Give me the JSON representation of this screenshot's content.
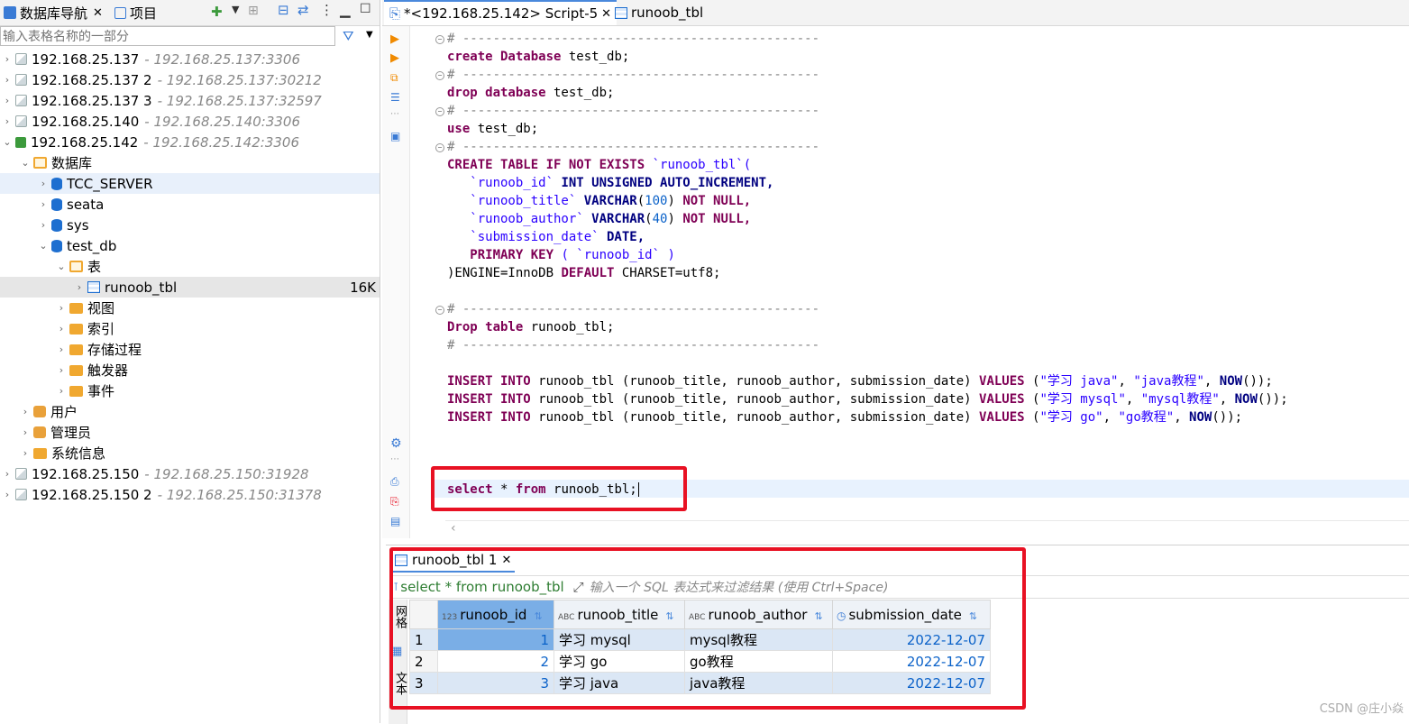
{
  "left_panel": {
    "tabs": [
      {
        "label": "数据库导航"
      },
      {
        "label": "项目"
      }
    ],
    "filter_placeholder": "输入表格名称的一部分",
    "tree": [
      {
        "label": "192.168.25.137",
        "addr": "- 192.168.25.137:3306"
      },
      {
        "label": "192.168.25.137 2",
        "addr": "- 192.168.25.137:30212"
      },
      {
        "label": "192.168.25.137 3",
        "addr": "- 192.168.25.137:32597"
      },
      {
        "label": "192.168.25.140",
        "addr": "- 192.168.25.140:3306"
      },
      {
        "label": "192.168.25.142",
        "addr": "- 192.168.25.142:3306"
      },
      {
        "label": "数据库"
      },
      {
        "label": "TCC_SERVER"
      },
      {
        "label": "seata"
      },
      {
        "label": "sys"
      },
      {
        "label": "test_db"
      },
      {
        "label": "表"
      },
      {
        "label": "runoob_tbl",
        "size": "16K"
      },
      {
        "label": "视图"
      },
      {
        "label": "索引"
      },
      {
        "label": "存储过程"
      },
      {
        "label": "触发器"
      },
      {
        "label": "事件"
      },
      {
        "label": "用户"
      },
      {
        "label": "管理员"
      },
      {
        "label": "系统信息"
      },
      {
        "label": "192.168.25.150",
        "addr": "- 192.168.25.150:31928"
      },
      {
        "label": "192.168.25.150 2",
        "addr": "- 192.168.25.150:31378"
      }
    ]
  },
  "editor": {
    "tabs": [
      {
        "label": "*<192.168.25.142> Script-5"
      },
      {
        "label": "runoob_tbl"
      }
    ],
    "lines": {
      "l1": "# -----------------------------------------------",
      "l2a": "create Database",
      "l2b": " test_db;",
      "l3": "# -----------------------------------------------",
      "l4a": "drop database",
      "l4b": " test_db;",
      "l5": "# -----------------------------------------------",
      "l6a": "use",
      "l6b": " test_db;",
      "l7": "# -----------------------------------------------",
      "l8a": "CREATE TABLE IF NOT EXISTS",
      "l8b": " `runoob_tbl`(",
      "l9a": "   `runoob_id`",
      "l9b": " INT UNSIGNED AUTO_INCREMENT,",
      "l10a": "   `runoob_title`",
      "l10b": " VARCHAR",
      "l10c": "(",
      "l10d": "100",
      "l10e": ")",
      "l10f": " NOT NULL,",
      "l11a": "   `runoob_author`",
      "l11b": " VARCHAR",
      "l11c": "(",
      "l11d": "40",
      "l11e": ")",
      "l11f": " NOT NULL,",
      "l12a": "   `submission_date`",
      "l12b": " DATE,",
      "l13a": "   PRIMARY KEY",
      "l13b": " ( `runoob_id` )",
      "l14a": ")ENGINE=InnoDB ",
      "l14b": "DEFAULT",
      "l14c": " CHARSET=utf8;",
      "l16": "# -----------------------------------------------",
      "l17a": "Drop table",
      "l17b": " runoob_tbl;",
      "l18": "# -----------------------------------------------",
      "ins1a": "INSERT INTO",
      "ins1b": " runoob_tbl (runoob_title, runoob_author, submission_date) ",
      "ins1c": "VALUES",
      "ins1d": " (",
      "ins1e": "\"学习 java\"",
      "ins1f": ", ",
      "ins1g": "\"java教程\"",
      "ins1h": ", ",
      "ins1i": "NOW",
      "ins1j": "());",
      "ins2a": "INSERT INTO",
      "ins2b": " runoob_tbl (runoob_title, runoob_author, submission_date) ",
      "ins2c": "VALUES",
      "ins2d": " (",
      "ins2e": "\"学习 mysql\"",
      "ins2f": ", ",
      "ins2g": "\"mysql教程\"",
      "ins2h": ", ",
      "ins2i": "NOW",
      "ins2j": "());",
      "ins3a": "INSERT INTO",
      "ins3b": " runoob_tbl (runoob_title, runoob_author, submission_date) ",
      "ins3c": "VALUES",
      "ins3d": " (",
      "ins3e": "\"学习 go\"",
      "ins3f": ", ",
      "ins3g": "\"go教程\"",
      "ins3h": ", ",
      "ins3i": "NOW",
      "ins3j": "());",
      "sel_a": "select",
      "sel_b": " * ",
      "sel_c": "from",
      "sel_d": " runoob_tbl;"
    }
  },
  "results": {
    "tab_label": "runoob_tbl 1",
    "query": "select * from runoob_tbl",
    "filter_hint": "输入一个 SQL 表达式来过滤结果 (使用 Ctrl+Space)",
    "side_labels": [
      "网格",
      "文本"
    ],
    "columns": [
      {
        "type": "123",
        "name": "runoob_id"
      },
      {
        "type": "ABC",
        "name": "runoob_title"
      },
      {
        "type": "ABC",
        "name": "runoob_author"
      },
      {
        "type": "◷",
        "name": "submission_date"
      }
    ],
    "rows": [
      {
        "n": "1",
        "id": "1",
        "title": "学习 mysql",
        "author": "mysql教程",
        "date": "2022-12-07"
      },
      {
        "n": "2",
        "id": "2",
        "title": "学习 go",
        "author": "go教程",
        "date": "2022-12-07"
      },
      {
        "n": "3",
        "id": "3",
        "title": "学习 java",
        "author": "java教程",
        "date": "2022-12-07"
      }
    ]
  },
  "watermark": "CSDN @庄小焱",
  "colors": {
    "accent": "#4a89dc",
    "highlight_box": "#e81123",
    "keyword": "#7f0055",
    "string": "#2a00ff"
  }
}
